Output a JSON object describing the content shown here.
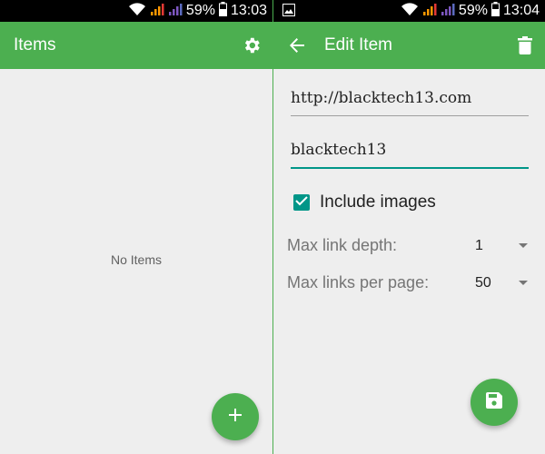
{
  "left": {
    "status": {
      "battery": "59%",
      "time": "13:03"
    },
    "appbar": {
      "title": "Items",
      "settings_icon": "gear-icon"
    },
    "empty_text": "No Items",
    "fab_icon": "plus-icon"
  },
  "right": {
    "status": {
      "battery": "59%",
      "time": "13:04"
    },
    "appbar": {
      "title": "Edit Item",
      "back_icon": "arrow-left-icon",
      "delete_icon": "trash-icon"
    },
    "url_value": "http://blacktech13.com",
    "name_value": "blacktech13",
    "include_images": {
      "label": "Include images",
      "checked": true
    },
    "max_link_depth": {
      "label": "Max link depth:",
      "value": "1"
    },
    "max_links_per_page": {
      "label": "Max links per page:",
      "value": "50"
    },
    "fab_icon": "save-icon"
  },
  "colors": {
    "primary": "#4caf50",
    "accent": "#009688",
    "background": "#eeeeee",
    "statusbar": "#000000"
  }
}
